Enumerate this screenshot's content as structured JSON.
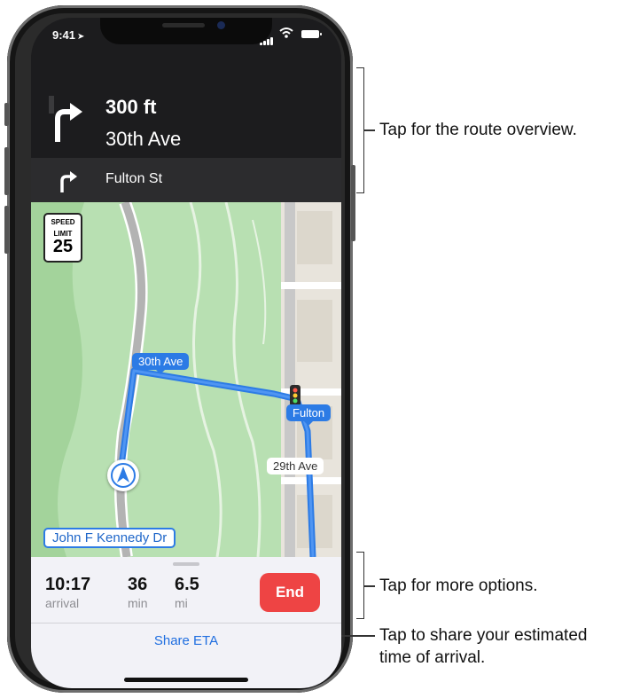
{
  "status_bar": {
    "time": "9:41",
    "location_glyph": "➤"
  },
  "navigation": {
    "distance": "300 ft",
    "street": "30th Ave",
    "next_street": "Fulton St"
  },
  "speed_limit": {
    "label_line1": "SPEED",
    "label_line2": "LIMIT",
    "value": "25"
  },
  "map_labels": {
    "route_start": "30th Ave",
    "route_cross": "Fulton",
    "side_street": "29th Ave",
    "road": "John F Kennedy Dr"
  },
  "trip": {
    "arrival_time": "10:17",
    "arrival_label": "arrival",
    "minutes": "36",
    "minutes_label": "min",
    "distance": "6.5",
    "distance_label": "mi",
    "end_label": "End",
    "share_label": "Share ETA"
  },
  "callouts": {
    "route_overview": "Tap for the route overview.",
    "more_options": "Tap for more options.",
    "share_line1": "Tap to share your estimated",
    "share_line2": "time of arrival."
  },
  "colors": {
    "route": "#2c7be5",
    "end_button": "#ee4444",
    "park": "#b8e0b2"
  }
}
